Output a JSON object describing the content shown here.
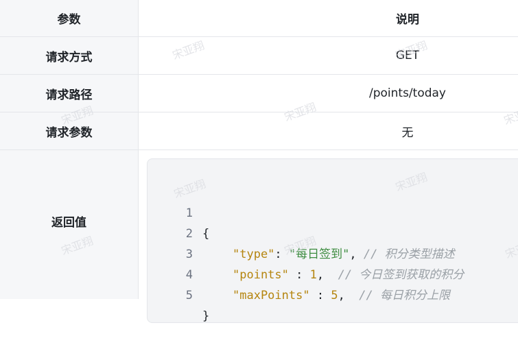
{
  "table": {
    "header": {
      "label": "参数",
      "value": "说明"
    },
    "rows": [
      {
        "label": "请求方式",
        "value": "GET"
      },
      {
        "label": "请求路径",
        "value": "/points/today"
      },
      {
        "label": "请求参数",
        "value": "无"
      },
      {
        "label": "返回值"
      }
    ]
  },
  "code": {
    "lines": [
      {
        "num": "1",
        "open": "{"
      },
      {
        "num": "2",
        "key": "\"type\"",
        "sep": ": ",
        "value": "\"每日签到\"",
        "tail": ",",
        "comment": " // 积分类型描述"
      },
      {
        "num": "3",
        "key": "\"points\"",
        "sep": " : ",
        "value": "1",
        "tail": ",",
        "comment": "  // 今日签到获取的积分"
      },
      {
        "num": "4",
        "key": "\"maxPoints\"",
        "sep": " : ",
        "value": "5",
        "tail": ",",
        "comment": "  // 每日积分上限"
      },
      {
        "num": "5",
        "close": "}"
      }
    ]
  },
  "watermark": "宋亚翔"
}
